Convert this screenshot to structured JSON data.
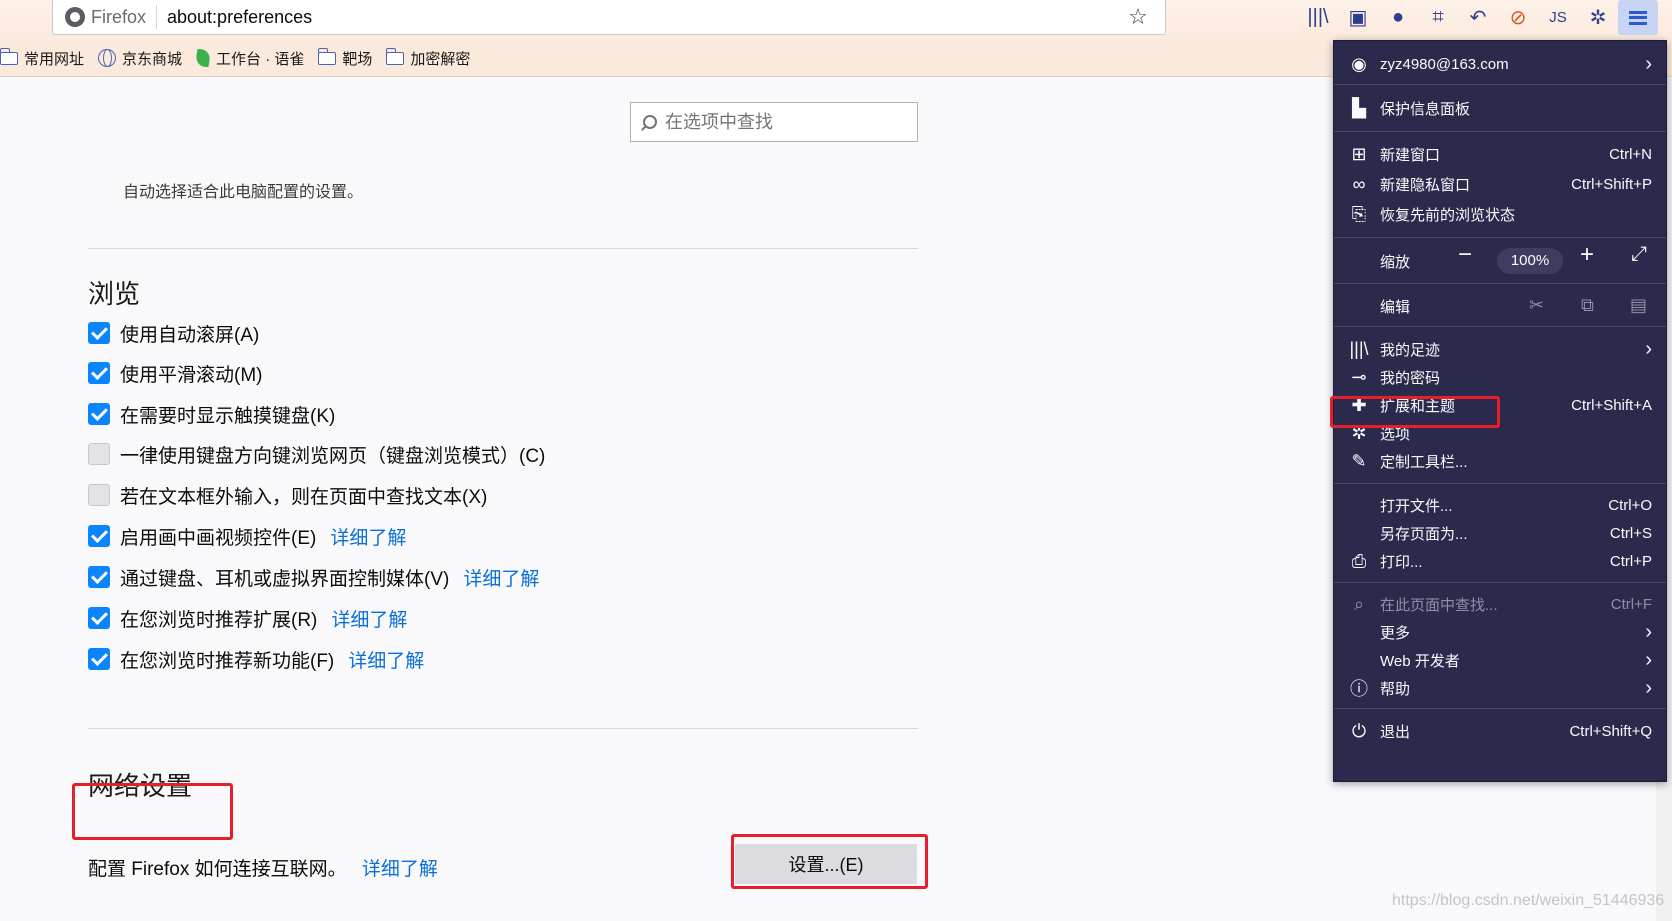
{
  "toolbar": {
    "brand": "Firefox",
    "url": "about:preferences"
  },
  "bookmarks": [
    {
      "label": "常用网址",
      "icon": "folder-icon"
    },
    {
      "label": "京东商城",
      "icon": "globe-icon"
    },
    {
      "label": "工作台 · 语雀",
      "icon": "leaf-icon"
    },
    {
      "label": "靶场",
      "icon": "folder-icon"
    },
    {
      "label": "加密解密",
      "icon": "folder-icon"
    }
  ],
  "prefs": {
    "search_placeholder": "在选项中查找",
    "auto_text": "自动选择适合此电脑配置的设置。",
    "browsing_title": "浏览",
    "checkboxes": [
      {
        "label": "使用自动滚屏(A)",
        "checked": true
      },
      {
        "label": "使用平滑滚动(M)",
        "checked": true
      },
      {
        "label": "在需要时显示触摸键盘(K)",
        "checked": true
      },
      {
        "label": "一律使用键盘方向键浏览网页（键盘浏览模式）(C)",
        "checked": false
      },
      {
        "label": "若在文本框外输入，则在页面中查找文本(X)",
        "checked": false
      },
      {
        "label": "启用画中画视频控件(E)",
        "checked": true,
        "learn_more": "详细了解"
      },
      {
        "label": "通过键盘、耳机或虚拟界面控制媒体(V)",
        "checked": true,
        "learn_more": "详细了解"
      },
      {
        "label": "在您浏览时推荐扩展(R)",
        "checked": true,
        "learn_more": "详细了解"
      },
      {
        "label": "在您浏览时推荐新功能(F)",
        "checked": true,
        "learn_more": "详细了解"
      }
    ],
    "network_title": "网络设置",
    "network_desc": "配置 Firefox 如何连接互联网。",
    "network_learn_more": "详细了解",
    "settings_button": "设置...(E)"
  },
  "menu": {
    "account": "zyz4980@163.com",
    "protection": "保护信息面板",
    "new_window": {
      "label": "新建窗口",
      "shortcut": "Ctrl+N"
    },
    "new_private": {
      "label": "新建隐私窗口",
      "shortcut": "Ctrl+Shift+P"
    },
    "restore": "恢复先前的浏览状态",
    "zoom_label": "缩放",
    "zoom_value": "100%",
    "edit_label": "编辑",
    "library": "我的足迹",
    "passwords": "我的密码",
    "addons": {
      "label": "扩展和主题",
      "shortcut": "Ctrl+Shift+A"
    },
    "options": "选项",
    "customize": "定制工具栏...",
    "open_file": {
      "label": "打开文件...",
      "shortcut": "Ctrl+O"
    },
    "save_as": {
      "label": "另存页面为...",
      "shortcut": "Ctrl+S"
    },
    "print": {
      "label": "打印...",
      "shortcut": "Ctrl+P"
    },
    "find": {
      "label": "在此页面中查找...",
      "shortcut": "Ctrl+F"
    },
    "more": "更多",
    "web_dev": "Web 开发者",
    "help": "帮助",
    "quit": {
      "label": "退出",
      "shortcut": "Ctrl+Shift+Q"
    }
  },
  "watermark": "https://blog.csdn.net/weixin_51446936"
}
